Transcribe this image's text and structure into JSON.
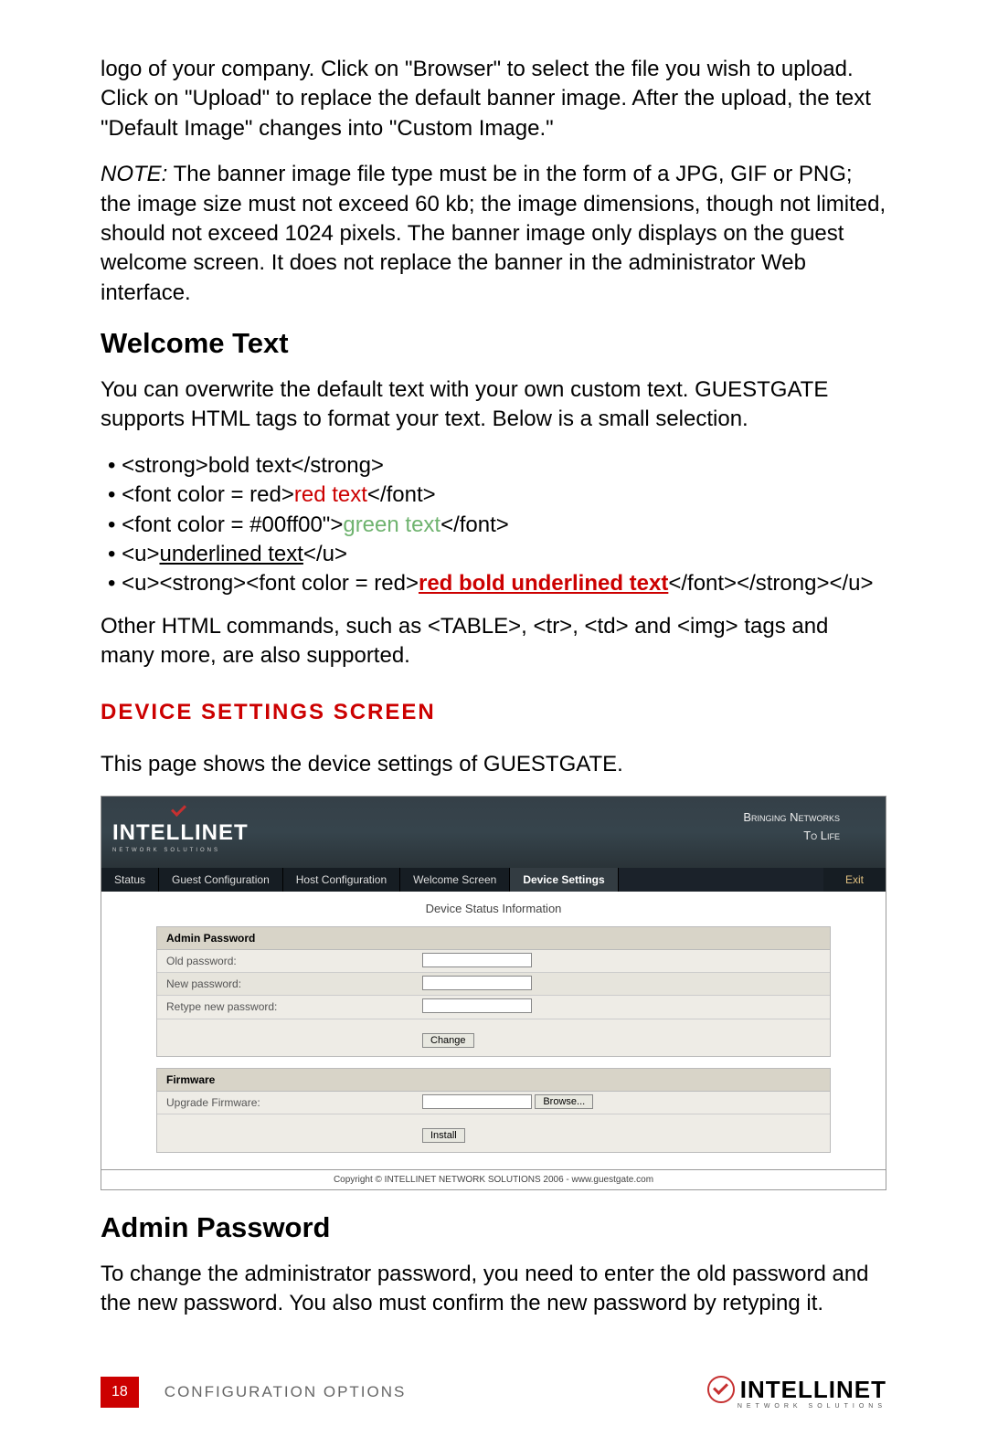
{
  "intro": {
    "p1": "logo of your company. Click on \"Browser\" to select the file you wish to upload. Click on \"Upload\" to replace the default banner image. After the upload, the text \"Default Image\" changes into \"Custom Image.\"",
    "note_label": "NOTE:",
    "note_body": " The banner image file type must be in the form of a JPG, GIF or PNG; the image size must not exceed 60 kb; the image dimensions, though not limited, should not exceed 1024 pixels. The banner image only displays on the guest welcome screen. It does not replace the banner in the administrator Web interface."
  },
  "welcome": {
    "heading": "Welcome Text",
    "p1": "You can overwrite the default text with your own custom text. GUESTGATE supports HTML tags to format your text. Below is a small selection.",
    "bullets": {
      "b1_pre": "<strong>",
      "b1_mid": "bold text",
      "b1_post": "</strong>",
      "b2_pre": "<font color = red>",
      "b2_mid": "red text",
      "b2_post": "</font>",
      "b3_pre": "<font color = #00ff00\">",
      "b3_mid": "green text",
      "b3_post": "</font>",
      "b4_pre": "<u>",
      "b4_mid": "underlined text",
      "b4_post": "</u>",
      "b5_pre": "<u><strong><font color = red>",
      "b5_mid": "red bold underlined text",
      "b5_post": "</font></strong></u>"
    },
    "p2": "Other HTML commands, such as <TABLE>, <tr>, <td> and <img> tags and many more, are also supported."
  },
  "device": {
    "heading": "Device Settings Screen",
    "intro": "This page shows the device settings of GUESTGATE."
  },
  "screenshot": {
    "brand": "INTELLINET",
    "brand_sub": "NETWORK SOLUTIONS",
    "tagline1": "Bringing Networks",
    "tagline2": "To Life",
    "tabs": {
      "status": "Status",
      "guest": "Guest Configuration",
      "host": "Host Configuration",
      "welcome": "Welcome Screen",
      "device": "Device Settings",
      "exit": "Exit"
    },
    "section_title": "Device Status Information",
    "admin_panel": {
      "header": "Admin Password",
      "old": "Old password:",
      "new": "New password:",
      "retype": "Retype new password:",
      "change_btn": "Change"
    },
    "firmware_panel": {
      "header": "Firmware",
      "upgrade": "Upgrade Firmware:",
      "browse_btn": "Browse...",
      "install_btn": "Install"
    },
    "copyright": "Copyright © INTELLINET NETWORK SOLUTIONS 2006 - www.guestgate.com"
  },
  "admin": {
    "heading": "Admin Password",
    "p1": "To change the administrator password, you need to enter the old password and the new password. You also must confirm the new password by retyping it."
  },
  "footer": {
    "page": "18",
    "section": "CONFIGURATION OPTIONS",
    "brand": "INTELLINET",
    "brand_sub": "NETWORK SOLUTIONS"
  }
}
